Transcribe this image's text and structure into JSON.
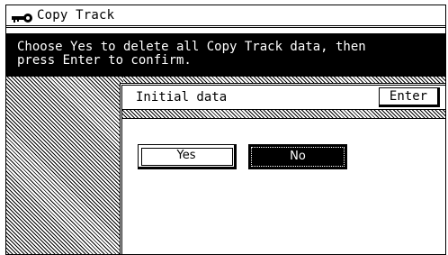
{
  "title_bar": {
    "icon": "key-icon",
    "title": "Copy Track"
  },
  "message": "Choose Yes to delete all Copy Track data, then\npress Enter to confirm.",
  "panel": {
    "title": "Initial data",
    "enter_label": "Enter",
    "choices": {
      "yes_label": "Yes",
      "no_label": "No",
      "selected": "No"
    }
  },
  "colors": {
    "foreground": "#000000",
    "background": "#ffffff"
  }
}
